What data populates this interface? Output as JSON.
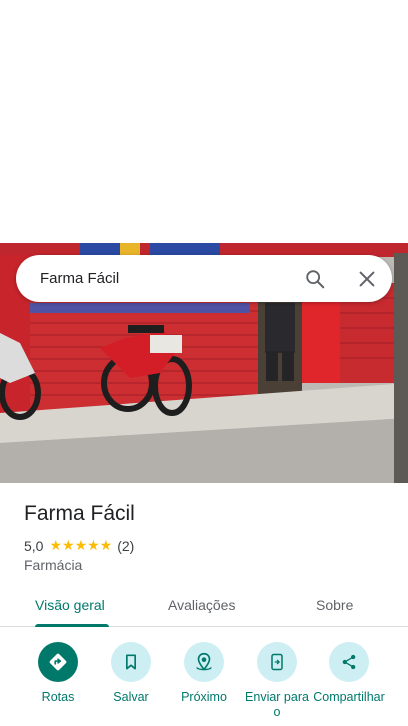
{
  "search": {
    "value": "Farma Fácil",
    "search_icon": "search-icon",
    "close_icon": "close-icon"
  },
  "place": {
    "name": "Farma Fácil",
    "rating": "5,0",
    "stars": "★★★★★",
    "review_count": "(2)",
    "category": "Farmácia"
  },
  "tabs": [
    {
      "label": "Visão geral",
      "active": true
    },
    {
      "label": "Avaliações",
      "active": false
    },
    {
      "label": "Sobre",
      "active": false
    }
  ],
  "actions": [
    {
      "label": "Rotas",
      "icon": "directions-icon"
    },
    {
      "label": "Salvar",
      "icon": "bookmark-icon"
    },
    {
      "label": "Próximo",
      "icon": "nearby-icon"
    },
    {
      "label": "Enviar para o",
      "icon": "send-to-phone-icon"
    },
    {
      "label": "Compartilhar",
      "icon": "share-icon"
    }
  ],
  "colors": {
    "accent": "#00796b",
    "action_bg": "#cdeff3",
    "star": "#fbbc04",
    "shutter_red": "#c8242b"
  }
}
